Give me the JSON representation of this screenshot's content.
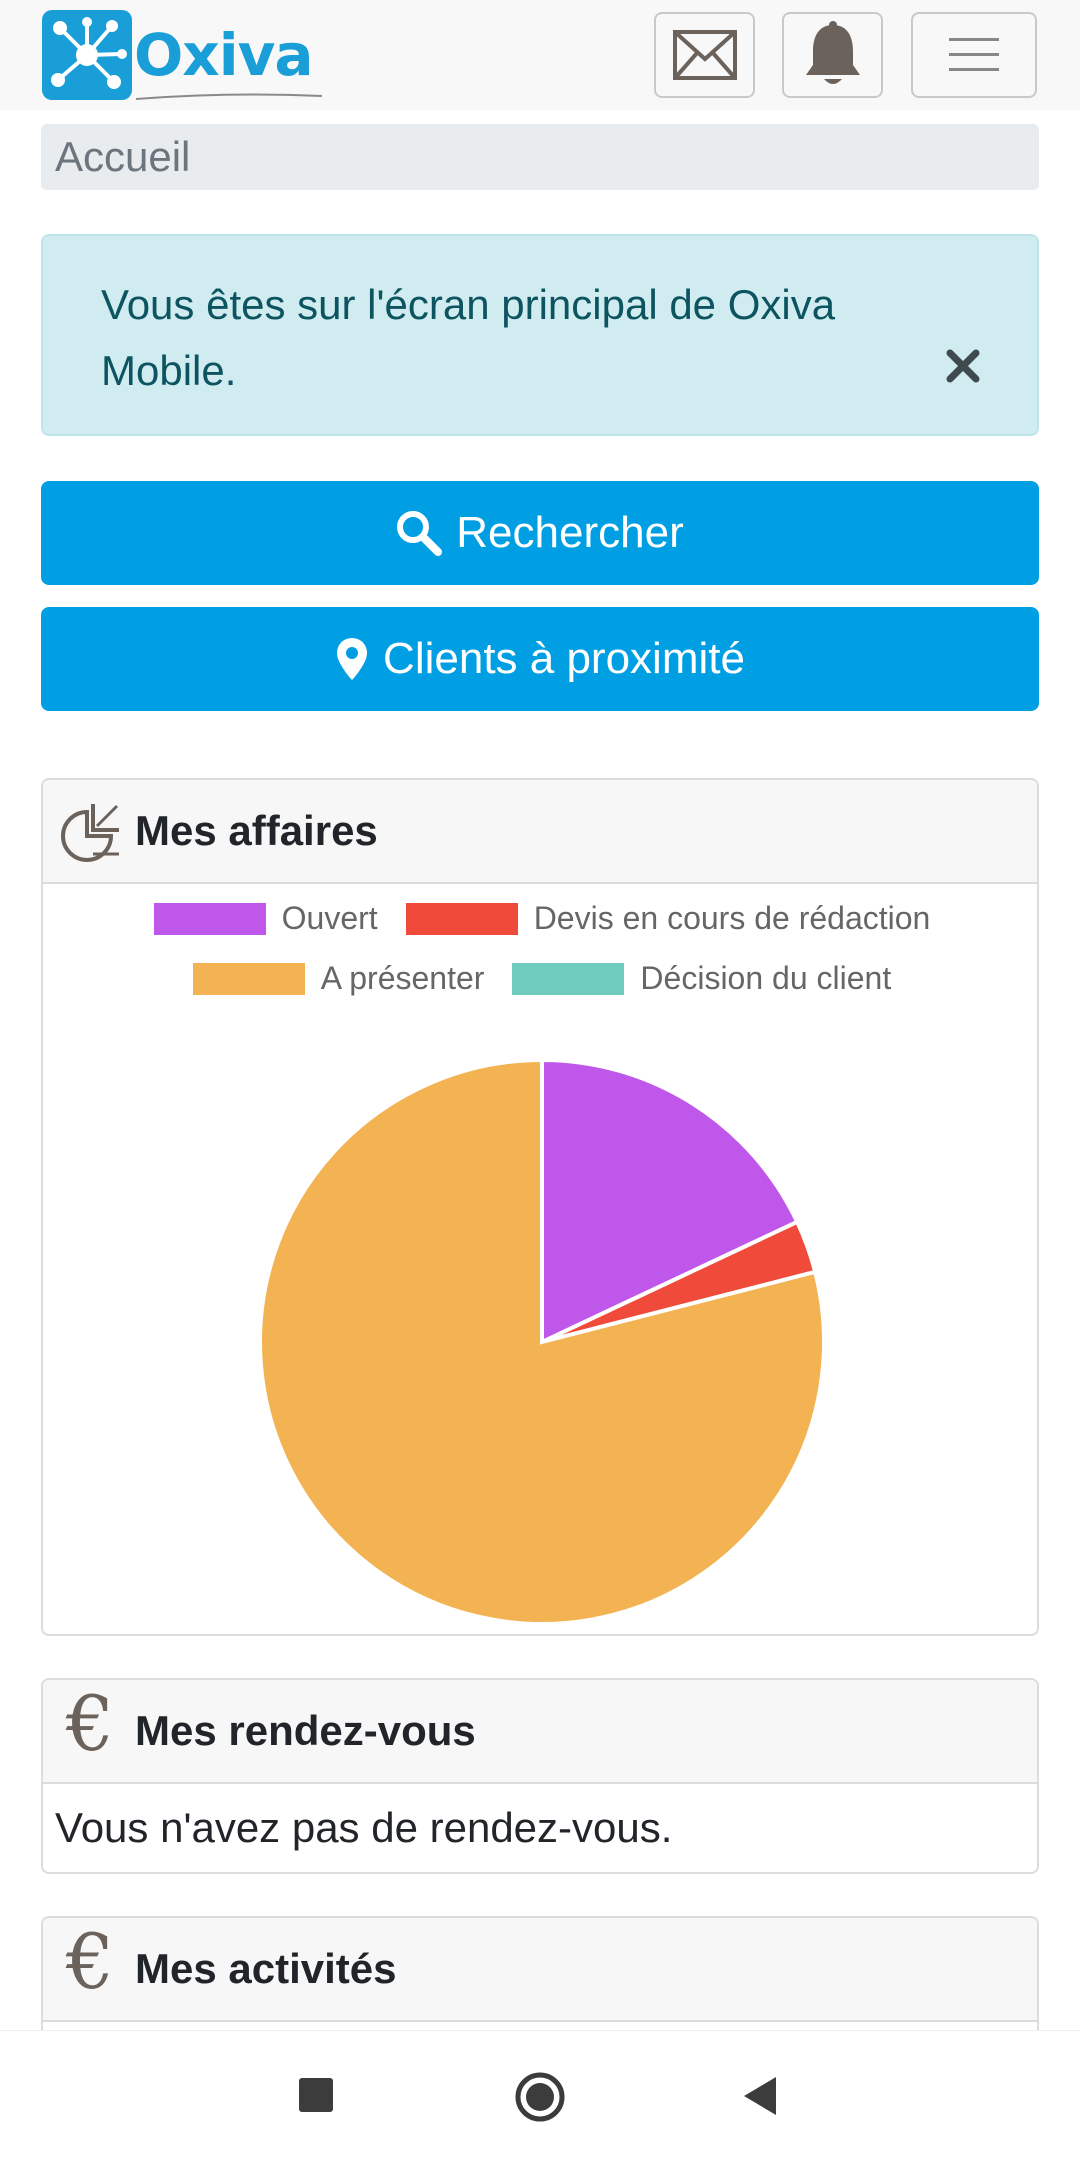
{
  "app": {
    "brand": "Oxiva"
  },
  "breadcrumb": {
    "current": "Accueil"
  },
  "alert": {
    "message": "Vous êtes sur l'écran principal de Oxiva Mobile."
  },
  "actions": {
    "search_label": "Rechercher",
    "nearby_label": "Clients à proximité"
  },
  "cards": {
    "affaires": {
      "title": "Mes affaires"
    },
    "rendezvous": {
      "title": "Mes rendez-vous",
      "empty_text": "Vous n'avez pas de rendez-vous."
    },
    "activites": {
      "title": "Mes activités"
    }
  },
  "colors": {
    "primary": "#009fe3",
    "alert_bg": "#d1ecf1",
    "alert_text": "#0c5460"
  },
  "chart_data": {
    "type": "pie",
    "categories": [
      "Ouvert",
      "Devis en cours de rédaction",
      "A présenter",
      "Décision du client"
    ],
    "values": [
      18,
      3,
      79,
      0
    ],
    "colors": [
      "#bf58ea",
      "#f04a3a",
      "#f4b352",
      "#6ecbbd"
    ],
    "legend": "top",
    "legend_rows": [
      [
        0,
        1
      ],
      [
        2,
        3
      ]
    ]
  }
}
